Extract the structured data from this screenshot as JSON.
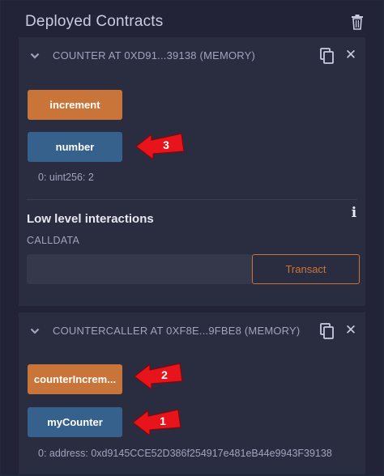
{
  "header": {
    "title": "Deployed Contracts"
  },
  "contracts": [
    {
      "label": "COUNTER AT 0XD91...39138 (MEMORY)",
      "buttons": [
        {
          "label": "increment",
          "kind": "transact"
        },
        {
          "label": "number",
          "kind": "call"
        }
      ],
      "result": "0: uint256: 2"
    },
    {
      "label": "COUNTERCALLER AT 0XF8E...9FBE8 (MEMORY)",
      "buttons": [
        {
          "label": "counterIncrem...",
          "kind": "transact"
        },
        {
          "label": "myCounter",
          "kind": "call"
        }
      ],
      "result": "0: address: 0xd9145CCE52D386f254917e481eB44e9943F39138"
    }
  ],
  "low_level": {
    "title": "Low level interactions",
    "calldata_label": "CALLDATA",
    "calldata_value": "",
    "transact_label": "Transact"
  },
  "annotations": [
    {
      "number": "3"
    },
    {
      "number": "2"
    },
    {
      "number": "1"
    }
  ],
  "colors": {
    "background": "#222336",
    "panel": "#2a2c3f",
    "transact_button": "#c97539",
    "call_button": "#35618c",
    "annotation_arrow": "#e8141b"
  },
  "icons": {
    "trash": "trash-icon",
    "chevron": "chevron-down-icon",
    "copy": "copy-icon",
    "close": "close-icon",
    "info": "info-icon"
  }
}
